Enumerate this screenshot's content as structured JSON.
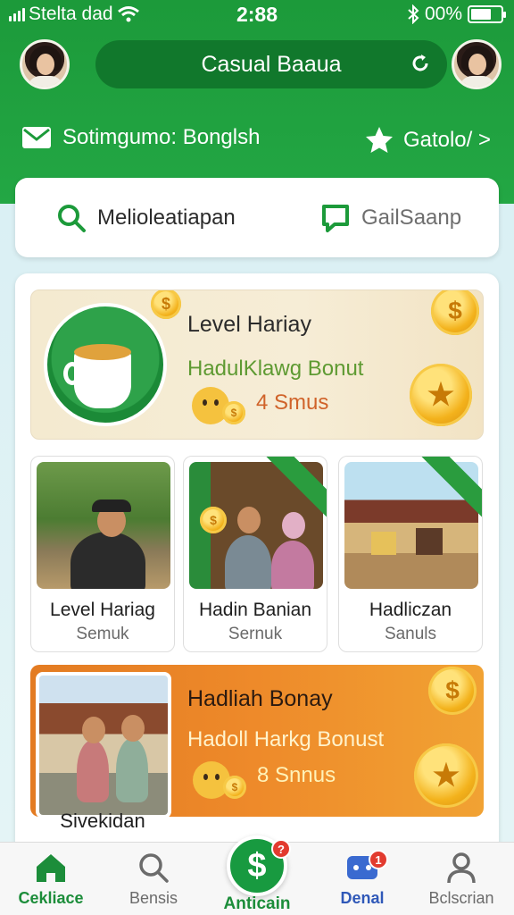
{
  "status_bar": {
    "carrier": "Stelta dad",
    "time": "2:88",
    "battery_text": "00%"
  },
  "header": {
    "title": "Casual Baaua",
    "left_item": "Sotimgumo: Bonglsh",
    "right_item": "Gatolo/ >"
  },
  "search": {
    "item_a": "Melioleatiapan",
    "item_b": "GailSaanp"
  },
  "promo_top": {
    "title": "Level Hariay",
    "subtitle": "HadulKlawg Bonut",
    "amount": "4 Smus"
  },
  "tiles": [
    {
      "title": "Level Hariag",
      "subtitle": "Semuk"
    },
    {
      "title": "Hadin Banian",
      "subtitle": "Sernuk"
    },
    {
      "title": "Hadliczan",
      "subtitle": "Sanuls"
    }
  ],
  "promo_bottom": {
    "title": "Hadliah Bonay",
    "subtitle": "Hadoll Harkg Bonust",
    "amount": "8 Snnus",
    "caption": "Sivekidan"
  },
  "nav": {
    "items": [
      {
        "label": "Cekliace",
        "icon": "home-icon"
      },
      {
        "label": "Bensis",
        "icon": "search-icon"
      },
      {
        "label": "Anticain",
        "icon": "dollar-icon",
        "badge": "?"
      },
      {
        "label": "Denal",
        "icon": "chat-icon",
        "badge": "1"
      },
      {
        "label": "Bclscrian",
        "icon": "user-icon"
      }
    ]
  },
  "colors": {
    "brand_green": "#1c9a3a",
    "accent_orange": "#e37b22",
    "badge_red": "#e23b2f"
  }
}
